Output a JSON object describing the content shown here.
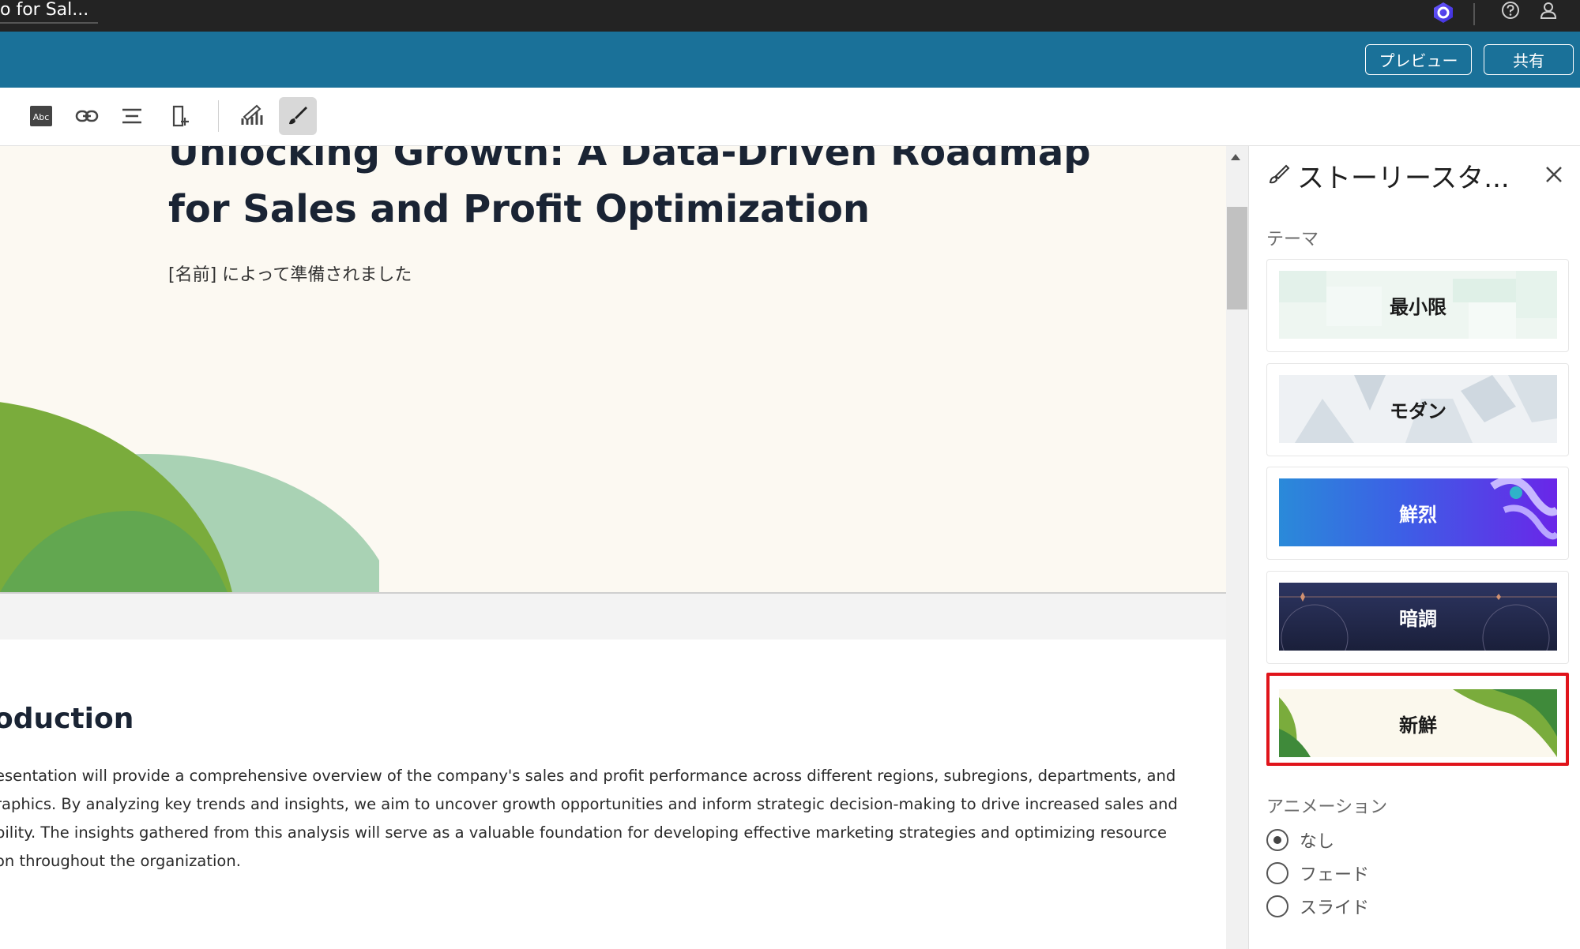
{
  "window": {
    "doc_tab_title": "o for Sal..."
  },
  "header": {
    "preview_label": "プレビュー",
    "share_label": "共有"
  },
  "toolbar": {
    "items": [
      "text-icon",
      "spellcheck-icon",
      "link-icon",
      "align-icon",
      "add-page-icon",
      "chart-edit-icon",
      "brush-icon"
    ]
  },
  "slide": {
    "title_line1": "Unlocking Growth: A Data-Driven Roadmap",
    "title_line2": "for Sales and Profit Optimization",
    "subtitle": "[名前] によって準備されました"
  },
  "section": {
    "heading": "oduction",
    "paragraph_lines": [
      "esentation will provide a comprehensive overview of the company's sales and profit performance across different regions, subregions, departments, and",
      "raphics. By analyzing key trends and insights, we aim to uncover growth opportunities and inform strategic decision-making to drive increased sales and",
      "bility. The insights gathered from this analysis will serve as a valuable foundation for developing effective marketing strategies and optimizing resource",
      "on throughout the organization."
    ]
  },
  "panel": {
    "title": "ストーリースタ...",
    "theme_label": "テーマ",
    "themes": [
      {
        "name": "最小限",
        "selected": false
      },
      {
        "name": "モダン",
        "selected": false
      },
      {
        "name": "鮮烈",
        "selected": false
      },
      {
        "name": "暗調",
        "selected": false
      },
      {
        "name": "新鮮",
        "selected": true
      }
    ],
    "animation_label": "アニメーション",
    "animation_options": [
      {
        "label": "なし",
        "checked": true
      },
      {
        "label": "フェード",
        "checked": false
      },
      {
        "label": "スライド",
        "checked": false
      }
    ]
  },
  "colors": {
    "header_blue": "#1a7199",
    "topbar": "#232323",
    "selection_red": "#e0141b",
    "slide_bg": "#fcf9f2"
  }
}
